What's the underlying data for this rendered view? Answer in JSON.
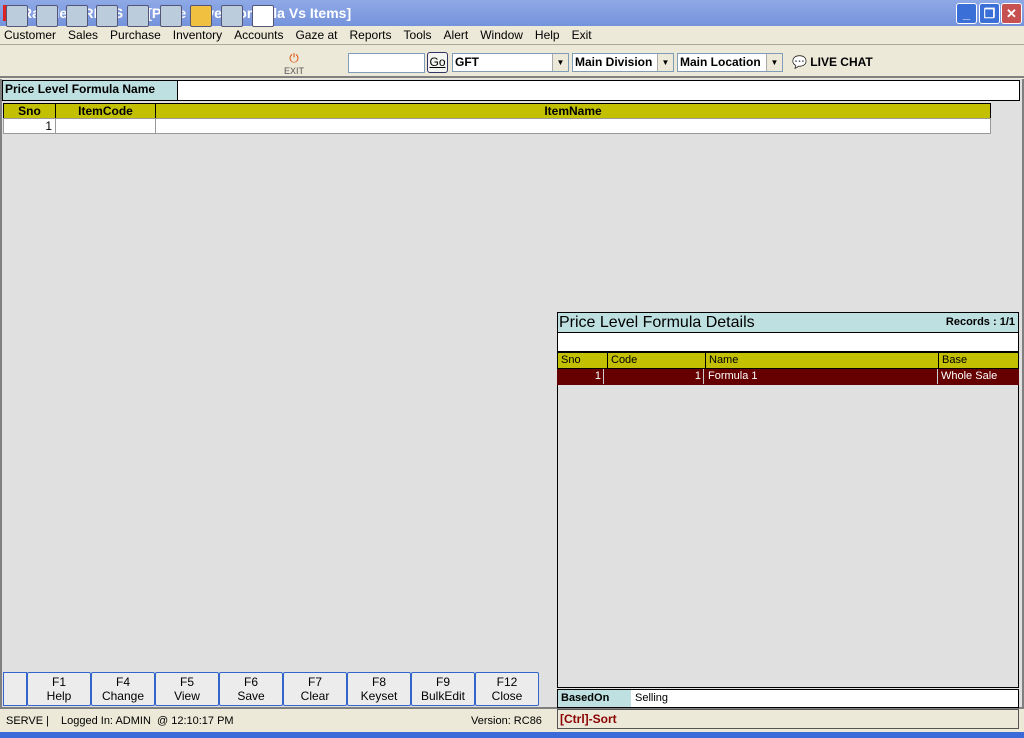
{
  "window": {
    "title": "RayMedi RPOS 7 - [Price Level Formula Vs Items]"
  },
  "menu": [
    "Customer",
    "Sales",
    "Purchase",
    "Inventory",
    "Accounts",
    "Gaze at",
    "Reports",
    "Tools",
    "Alert",
    "Window",
    "Help",
    "Exit"
  ],
  "toolbar": {
    "exit_label": "EXIT",
    "search_value": "",
    "go_label": "Go",
    "store_value": "GFT",
    "division_value": "Main Division",
    "location_value": "Main Location",
    "live_chat": "LIVE CHAT"
  },
  "form": {
    "formula_name_label": "Price Level Formula Name",
    "formula_name_value": ""
  },
  "items_grid": {
    "columns": [
      "Sno",
      "ItemCode",
      "ItemName"
    ],
    "rows": [
      {
        "sno": "1",
        "code": "",
        "name": ""
      }
    ]
  },
  "details": {
    "title": "Price Level Formula Details",
    "records": "Records : 1/1",
    "columns": [
      "Sno",
      "Code",
      "Name",
      "Base"
    ],
    "rows": [
      {
        "sno": "1",
        "code": "1",
        "name": "Formula 1",
        "base": "Whole Sale"
      }
    ],
    "based_on_label": "BasedOn",
    "based_on_value": "Selling",
    "sort_hint": "[Ctrl]-Sort"
  },
  "fkeys": [
    {
      "key": "F1",
      "label": "Help"
    },
    {
      "key": "F4",
      "label": "Change"
    },
    {
      "key": "F5",
      "label": "View"
    },
    {
      "key": "F6",
      "label": "Save"
    },
    {
      "key": "F7",
      "label": "Clear"
    },
    {
      "key": "F8",
      "label": "Keyset"
    },
    {
      "key": "F9",
      "label": "BulkEdit"
    },
    {
      "key": "F12",
      "label": "Close"
    }
  ],
  "status": {
    "server": "SERVE |",
    "login": "Logged In: ADMIN  @ 12:10:17 PM",
    "version": "Version: RC86"
  }
}
